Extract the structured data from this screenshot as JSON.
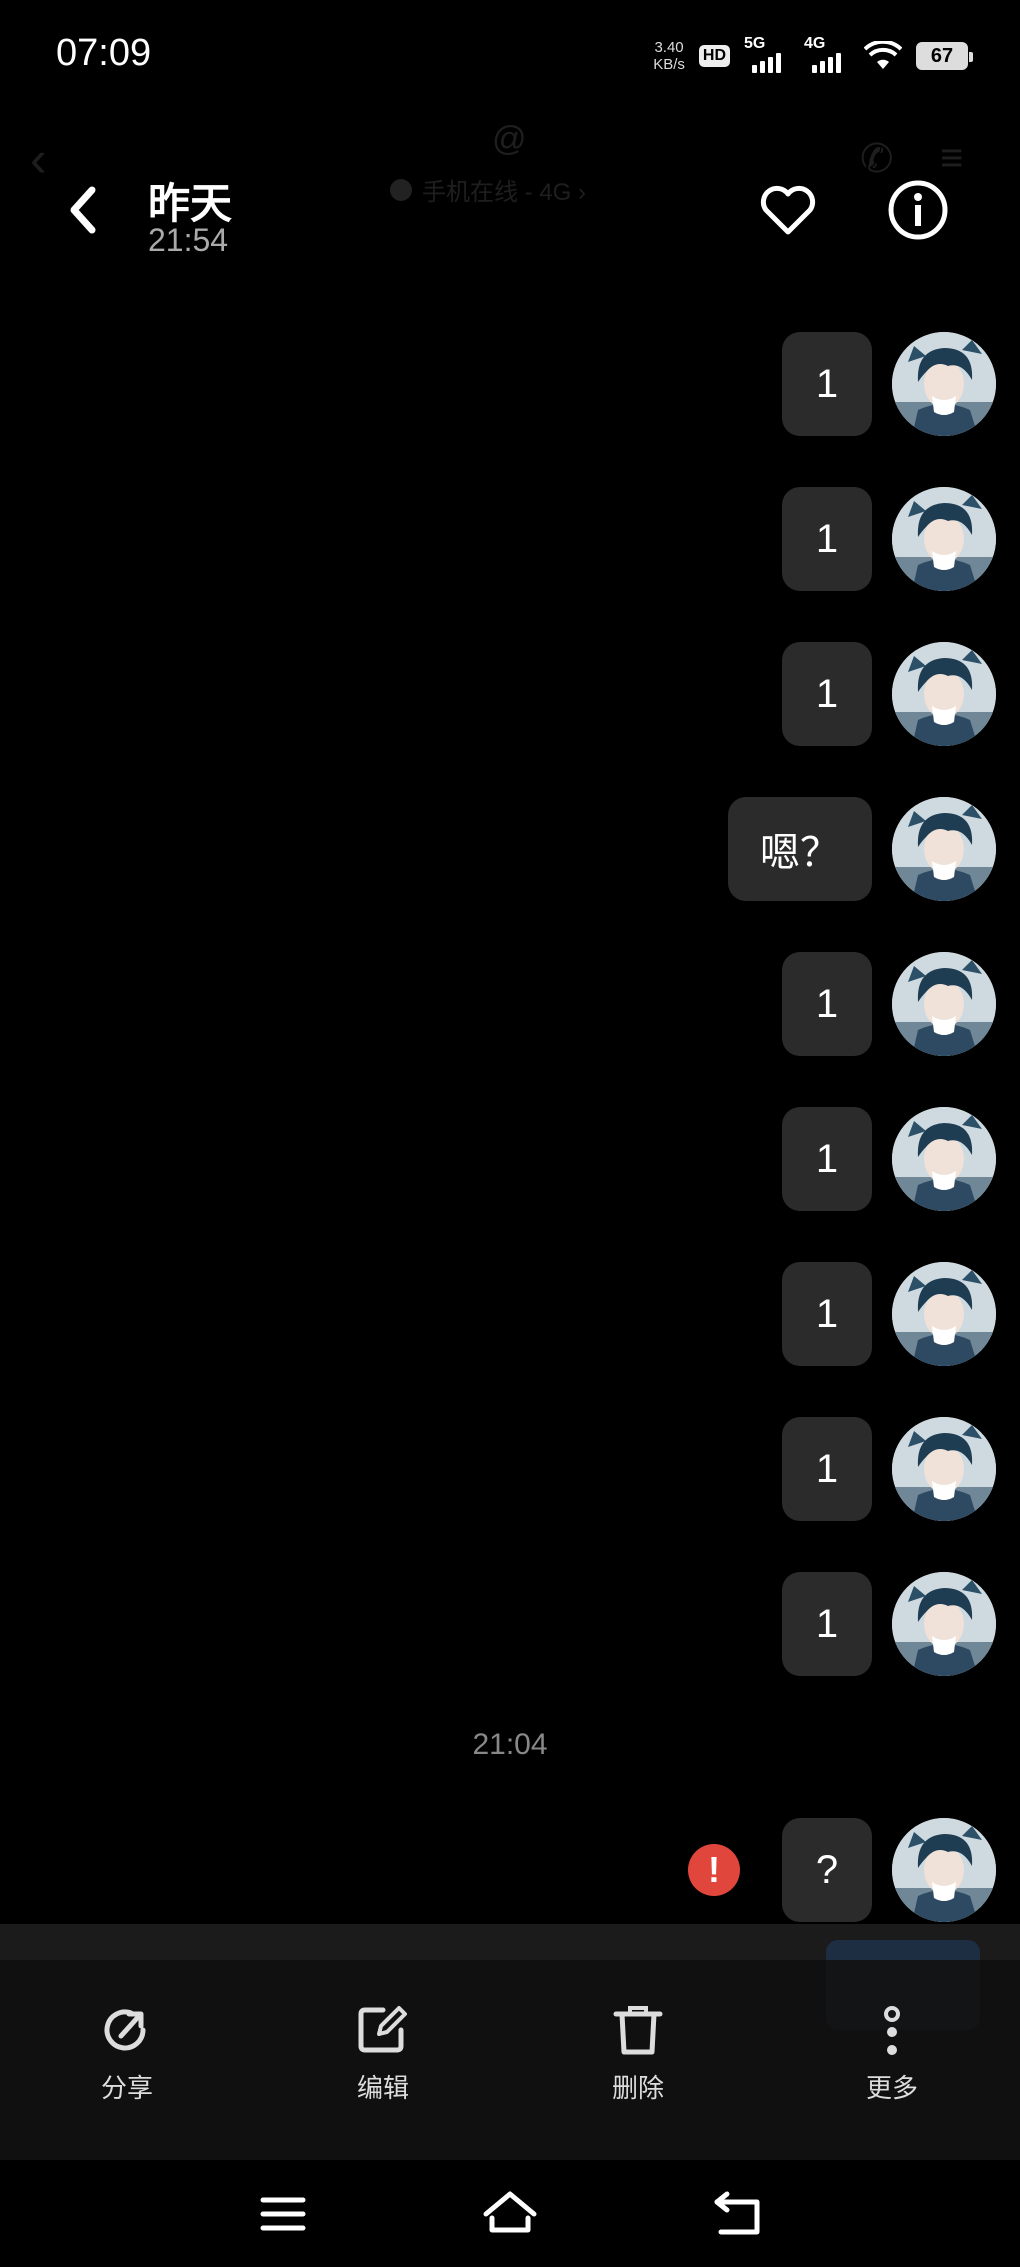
{
  "status_bar": {
    "time": "07:09",
    "speed_value": "3.40",
    "speed_unit": "KB/s",
    "hd": "HD",
    "network_1": "5G",
    "network_2": "4G",
    "battery": "67"
  },
  "background_chat": {
    "at_symbol": "@",
    "online_status": "手机在线 - 4G ›"
  },
  "viewer": {
    "title": "昨天",
    "subtitle": "21:54"
  },
  "messages": [
    {
      "text": "1"
    },
    {
      "text": "1"
    },
    {
      "text": "1"
    },
    {
      "text": "嗯？"
    },
    {
      "text": "1"
    },
    {
      "text": "1"
    },
    {
      "text": "1"
    },
    {
      "text": "1"
    },
    {
      "text": "1"
    }
  ],
  "time_divider": "21:04",
  "last_message": {
    "text": "?",
    "status": "failed"
  },
  "actions": {
    "share": "分享",
    "edit": "编辑",
    "delete": "删除",
    "more": "更多"
  },
  "colors": {
    "background": "#000000",
    "bubble": "#2b2b2b",
    "error": "#e0463c"
  }
}
